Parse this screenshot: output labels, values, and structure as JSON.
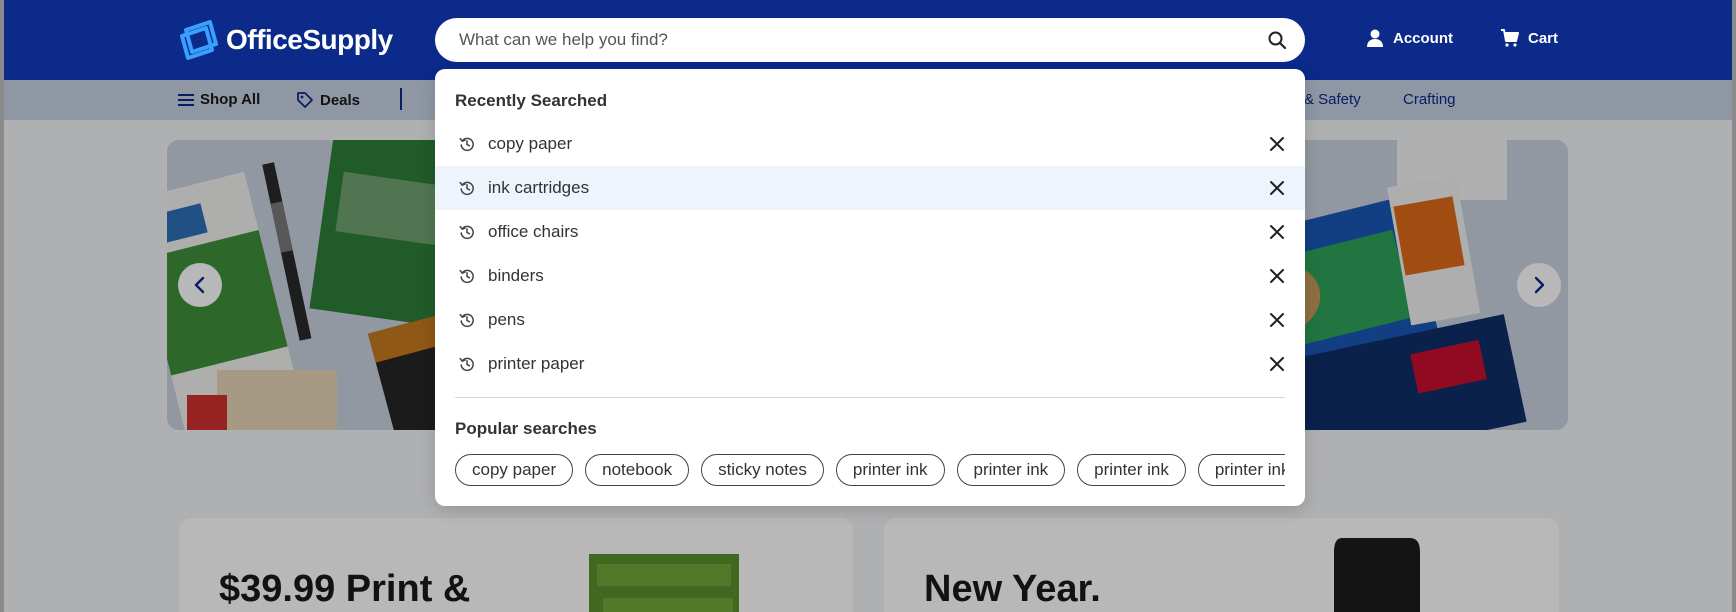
{
  "brand": {
    "name": "OfficeSupply",
    "color": "#0b2a8a"
  },
  "search": {
    "placeholder": "What can we help you find?",
    "value": ""
  },
  "header": {
    "account_label": "Account",
    "cart_label": "Cart"
  },
  "nav": {
    "items": [
      {
        "label": "Shop All",
        "icon": "menu-icon"
      },
      {
        "label": "Deals",
        "icon": "tag-icon"
      },
      {
        "label": "& Safety"
      },
      {
        "label": "Crafting"
      }
    ]
  },
  "hero": {
    "prev_icon": "chevron-left-icon",
    "next_icon": "chevron-right-icon"
  },
  "promos": [
    {
      "title": "$39.99 Print &"
    },
    {
      "title": "New Year."
    }
  ],
  "dropdown": {
    "recent_heading": "Recently Searched",
    "recent": [
      {
        "text": "copy paper",
        "highlighted": false
      },
      {
        "text": "ink cartridges",
        "highlighted": true
      },
      {
        "text": "office chairs",
        "highlighted": false
      },
      {
        "text": "binders",
        "highlighted": false
      },
      {
        "text": "pens",
        "highlighted": false
      },
      {
        "text": "printer paper",
        "highlighted": false
      }
    ],
    "popular_heading": "Popular searches",
    "popular": [
      "copy paper",
      "notebook",
      "sticky notes",
      "printer ink",
      "printer ink",
      "printer ink",
      "printer ink"
    ]
  }
}
